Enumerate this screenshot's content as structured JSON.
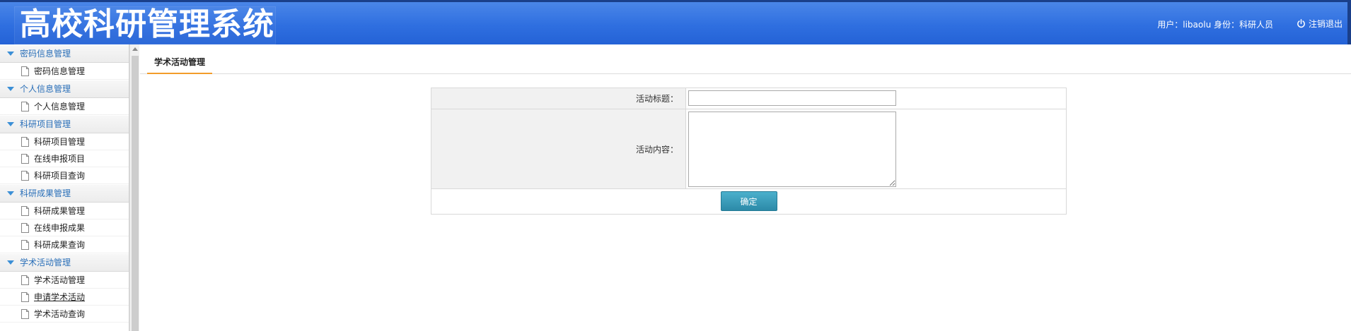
{
  "header": {
    "title": "高校科研管理系统",
    "user_info": "用户：libaolu 身份：科研人员",
    "logout_label": "注销退出"
  },
  "sidebar": {
    "groups": [
      {
        "title": "密码信息管理",
        "items": [
          "密码信息管理"
        ]
      },
      {
        "title": "个人信息管理",
        "items": [
          "个人信息管理"
        ]
      },
      {
        "title": "科研项目管理",
        "items": [
          "科研项目管理",
          "在线申报项目",
          "科研项目查询"
        ]
      },
      {
        "title": "科研成果管理",
        "items": [
          "科研成果管理",
          "在线申报成果",
          "科研成果查询"
        ]
      },
      {
        "title": "学术活动管理",
        "items": [
          "学术活动管理",
          "申请学术活动",
          "学术活动查询"
        ]
      }
    ]
  },
  "main": {
    "tab_label": "学术活动管理",
    "form": {
      "title_label": "活动标题：",
      "title_value": "",
      "content_label": "活动内容：",
      "content_value": "",
      "submit_label": "确定"
    }
  }
}
